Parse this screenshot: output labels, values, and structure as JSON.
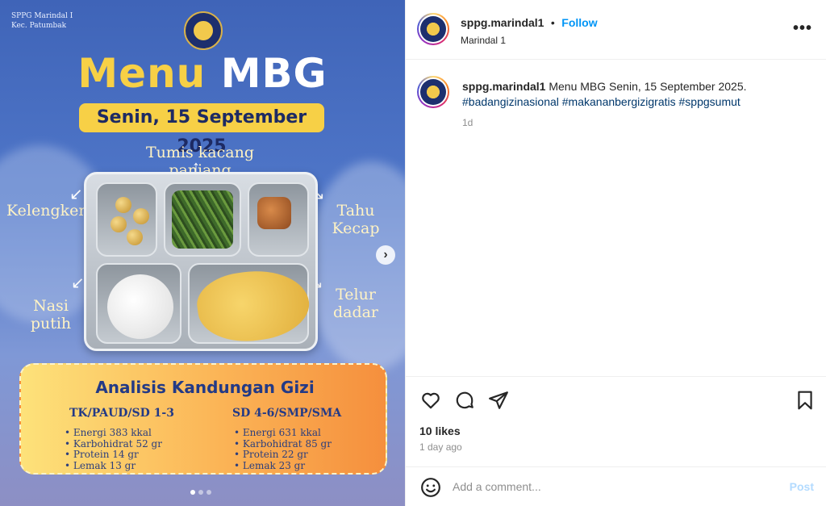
{
  "media": {
    "org_line1": "SPPG Marindal I",
    "org_line2": "Kec. Patumbak",
    "title_part1": "Menu",
    "title_part2": "MBG",
    "date": "Senin, 15 September 2025",
    "labels": {
      "top": "Tumis kacang panjang",
      "left_top": "Kelengkeng",
      "right_top_1": "Tahu",
      "right_top_2": "Kecap",
      "left_bottom_1": "Nasi",
      "left_bottom_2": "putih",
      "right_bottom_1": "Telur",
      "right_bottom_2": "dadar"
    },
    "nutrition": {
      "title": "Analisis Kandungan Gizi",
      "col1_header": "TK/PAUD/SD 1-3",
      "col1_items": [
        "Energi 383 kkal",
        "Karbohidrat 52 gr",
        "Protein 14 gr",
        "Lemak 13 gr"
      ],
      "col2_header": "SD 4-6/SMP/SMA",
      "col2_items": [
        "Energi 631 kkal",
        "Karbohidrat 85 gr",
        "Protein 22 gr",
        "Lemak 23 gr"
      ]
    },
    "next_icon": "›",
    "carousel_count": 3,
    "carousel_active": 1
  },
  "header": {
    "username": "sppg.marindal1",
    "separator": "•",
    "follow": "Follow",
    "location": "Marindal 1",
    "more_icon": "•••"
  },
  "caption": {
    "username": "sppg.marindal1",
    "text": "Menu MBG Senin, 15 September 2025.",
    "hashtags": "#badangizinasional #makananbergizigratis #sppgsumut",
    "time": "1d"
  },
  "actions": {
    "likes": "10 likes",
    "time_ago": "1 day ago",
    "icons": [
      "heart-icon",
      "comment-icon",
      "share-icon",
      "bookmark-icon"
    ]
  },
  "comment": {
    "placeholder": "Add a comment...",
    "post_label": "Post"
  },
  "colors": {
    "follow_blue": "#0095f6",
    "hashtag": "#00376b",
    "muted": "#8e8e8e",
    "post_disabled": "#b3dbff"
  }
}
